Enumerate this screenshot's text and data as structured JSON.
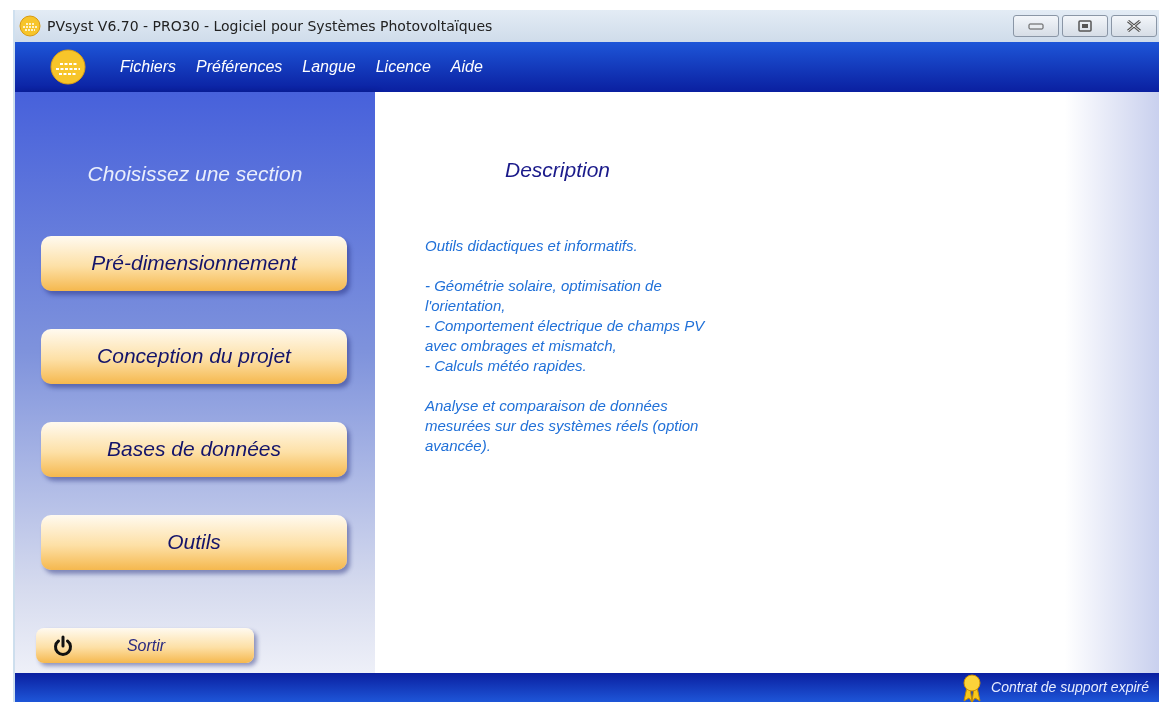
{
  "window": {
    "title": "PVsyst V6.70 - PRO30 - Logiciel pour Systèmes Photovoltaïques"
  },
  "menu": [
    "Fichiers",
    "Préférences",
    "Langue",
    "Licence",
    "Aide"
  ],
  "sidebar": {
    "heading": "Choisissez une section",
    "sections": [
      "Pré-dimensionnement",
      "Conception du projet",
      "Bases de données",
      "Outils"
    ],
    "exit_button": "Sortir"
  },
  "description": {
    "title": "Description",
    "blocks": [
      [
        "Outils didactiques et informatifs."
      ],
      [
        "- Géométrie solaire, optimisation de l'orientation,",
        "- Comportement électrique de champs PV avec ombrages et mismatch,",
        "- Calculs météo rapides."
      ],
      [
        "Analyse et comparaison de données mesurées sur des systèmes réels (option avancée)."
      ]
    ]
  },
  "status_bar": {
    "text": "Contrat de support expiré"
  }
}
